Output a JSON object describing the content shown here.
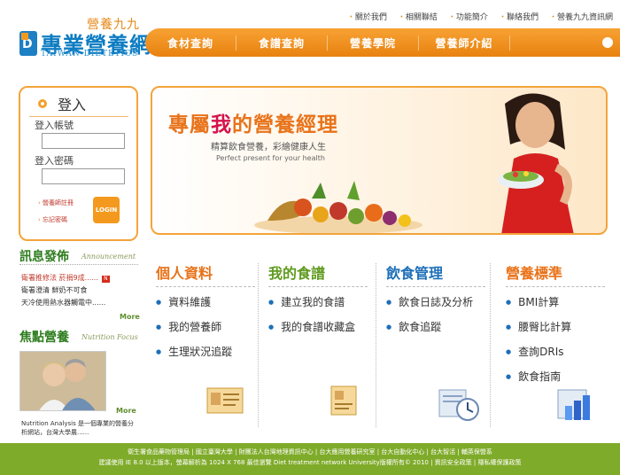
{
  "top_links": [
    "關於我們",
    "相關聯結",
    "功能簡介",
    "聯絡我們",
    "營養九九資訊網"
  ],
  "logo": {
    "sub": "營養九九",
    "title": "專業營養網",
    "en": "TAIWAN DIETETICS"
  },
  "nav": [
    "食材查詢",
    "食譜查詢",
    "營養學院",
    "營養師介紹"
  ],
  "login": {
    "title": "登入",
    "account_label": "登入帳號",
    "password_label": "登入密碼",
    "account_value": "",
    "password_value": "",
    "links": [
      "營養師註冊",
      "忘記密碼"
    ],
    "button": "LOGIN"
  },
  "news": {
    "title": "訊息發佈",
    "subtitle": "Announcement",
    "items": [
      "衛署推修法 菸捐9成......",
      "衛署澄清 鮮奶不可食",
      "天冷使用熱水器觸電中......"
    ],
    "new_badge": "N",
    "more": "More"
  },
  "focus": {
    "title": "焦點營養",
    "subtitle": "Nutrition Focus",
    "text": "Nutrition Analysis 是一個專業的營養分析網站，台灣大學農......",
    "more": "More"
  },
  "banner": {
    "title_pre": "專屬",
    "title_em": "我",
    "title_post": "的營養經理",
    "subtitle": "精算飲食營養，彩繪健康人生",
    "en": "Perfect present for your health"
  },
  "categories": [
    {
      "title": "個人資料",
      "color": "#e8731a",
      "items": [
        "資料維護",
        "我的營養師",
        "生理狀況追蹤"
      ]
    },
    {
      "title": "我的食譜",
      "color": "#5f9a1e",
      "items": [
        "建立我的食譜",
        "我的食譜收藏盒"
      ]
    },
    {
      "title": "飲食管理",
      "color": "#1e6fb8",
      "items": [
        "飲食日誌及分析",
        "飲食追蹤"
      ]
    },
    {
      "title": "營養標準",
      "color": "#e8731a",
      "items": [
        "BMI計算",
        "腰臀比計算",
        "查詢DRIs",
        "飲食指南"
      ]
    }
  ],
  "footer": {
    "line1": "衛生署食品藥物管理局 | 國立臺灣大學 | 財團法人台灣地理資訊中心 | 台大應用營養研究室 | 台大自動化中心 | 台大智活 | 輔英保營系",
    "line2": "建議使用 IE 8.0 以上版本，螢幕解析為 1024 X 768 最佳瀏覽 Diet treatment network University版權所有© 2010 | 資訊安全政策 | 隱私權保護政策"
  }
}
